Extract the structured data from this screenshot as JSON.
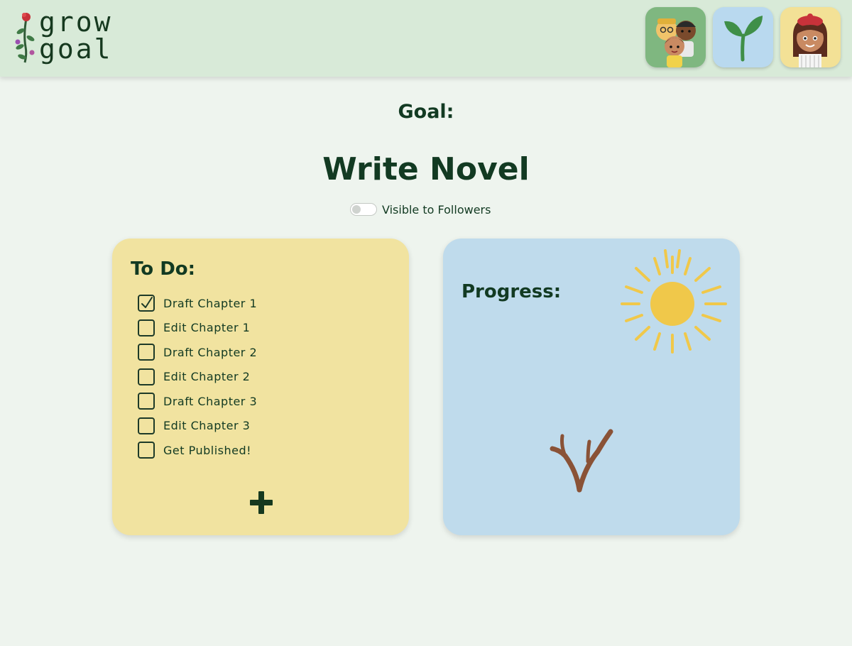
{
  "app": {
    "name_line1": "grow",
    "name_line2": "goal"
  },
  "nav": [
    {
      "name": "friends-nav-button",
      "icon": "friends-group-icon",
      "color": "#7fb780"
    },
    {
      "name": "goals-nav-button",
      "icon": "sprout-icon",
      "color": "#b9d9ef"
    },
    {
      "name": "profile-nav-button",
      "icon": "user-avatar-icon",
      "color": "#f3e196"
    }
  ],
  "goal": {
    "label": "Goal:",
    "title": "Write Novel",
    "visibility_label": "Visible to Followers",
    "visible": false
  },
  "todo": {
    "title": "To Do:",
    "items": [
      {
        "label": "Draft Chapter 1",
        "checked": true
      },
      {
        "label": "Edit Chapter 1",
        "checked": false
      },
      {
        "label": "Draft Chapter 2",
        "checked": false
      },
      {
        "label": "Edit Chapter 2",
        "checked": false
      },
      {
        "label": "Draft Chapter 3",
        "checked": false
      },
      {
        "label": "Edit Chapter 3",
        "checked": false
      },
      {
        "label": "Get Published!",
        "checked": false
      }
    ],
    "add_icon": "plus-icon"
  },
  "progress": {
    "title": "Progress:",
    "tasks_completed": 1,
    "tasks_total": 7,
    "illustration": "sapling-twig-icon",
    "decoration": "sun-icon"
  },
  "colors": {
    "background": "#eef4ee",
    "header": "#d8ead8",
    "text": "#123a22",
    "todo_card": "#f1e3a0",
    "progress_card": "#bfdbec",
    "sun": "#f0c84a",
    "twig": "#8a5236"
  }
}
